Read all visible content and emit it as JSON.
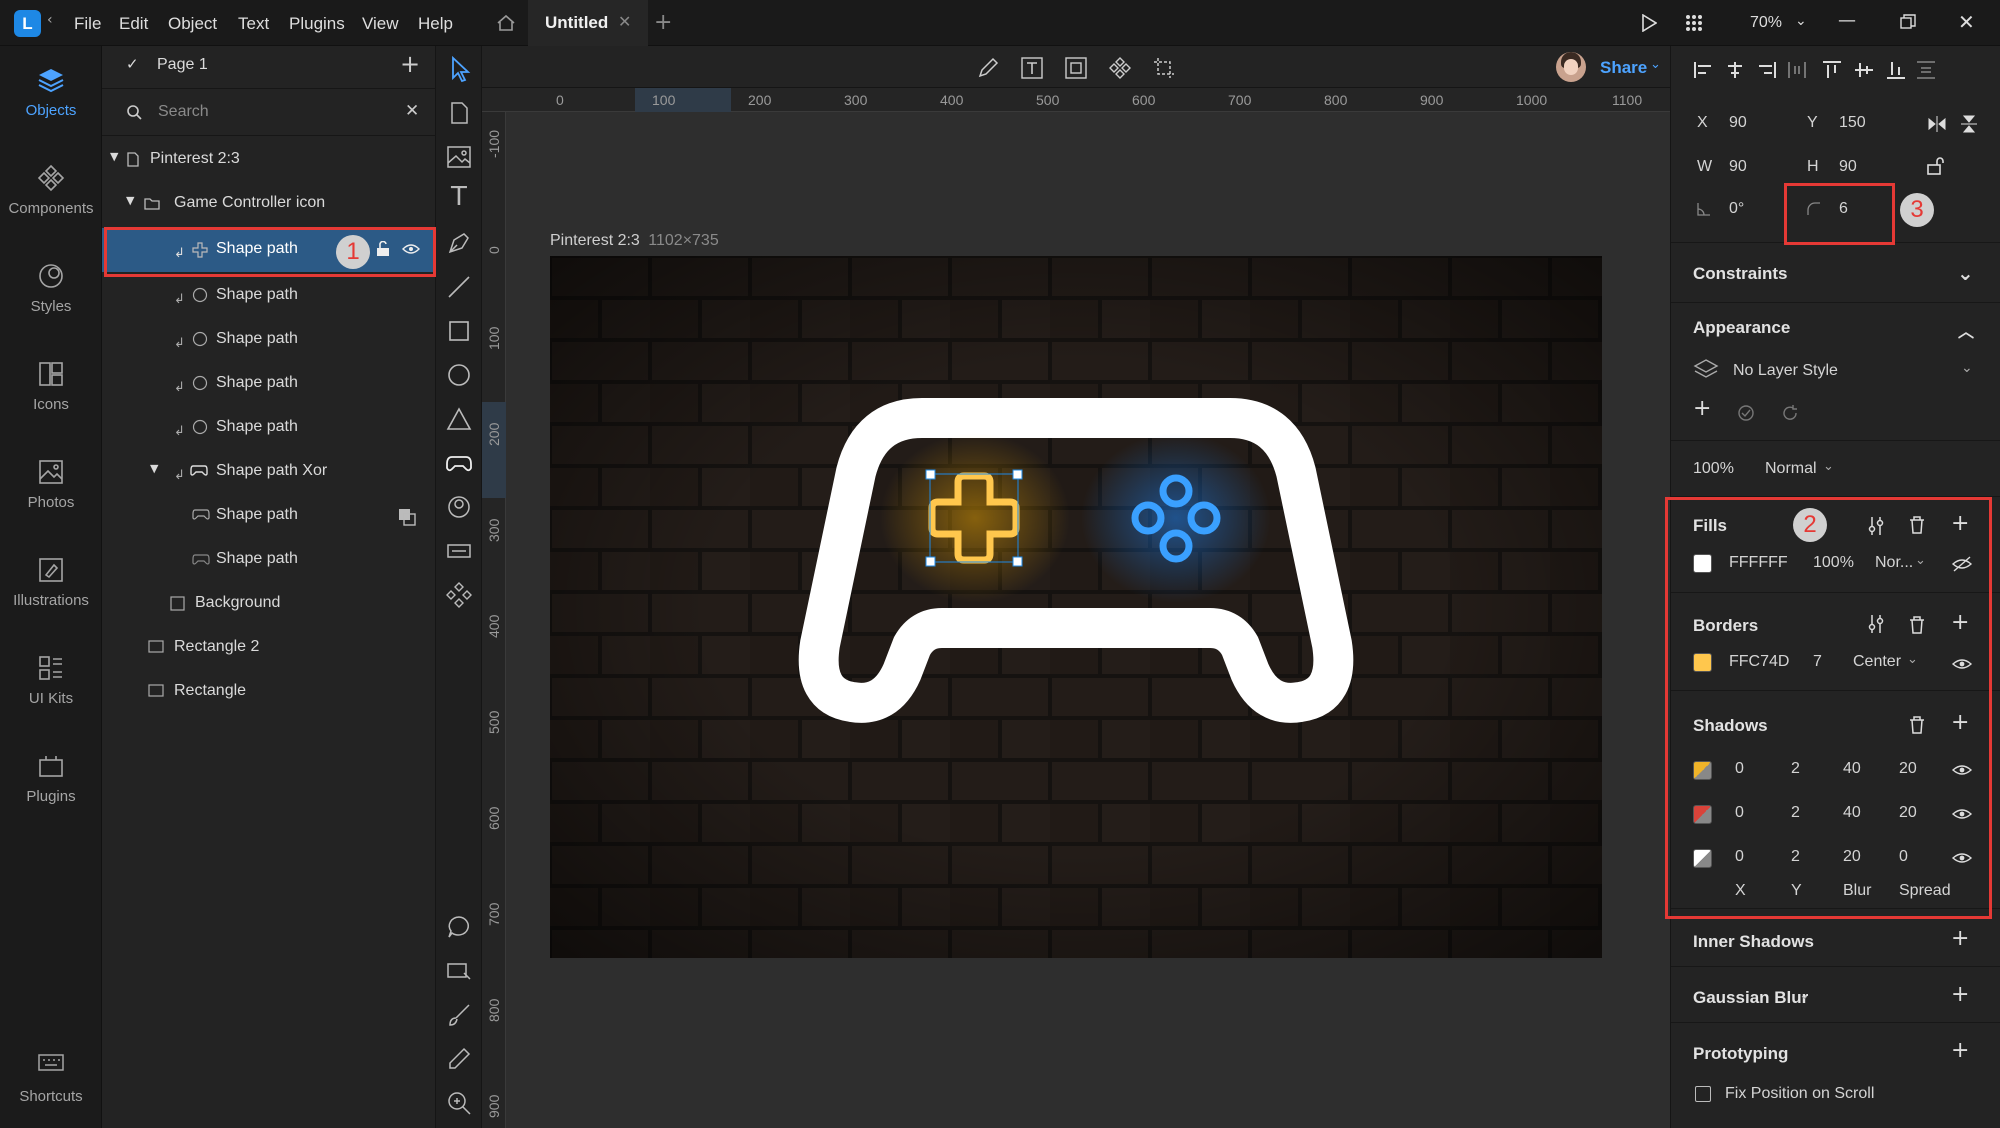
{
  "menubar": {
    "items": [
      "File",
      "Edit",
      "Object",
      "Text",
      "Plugins",
      "View",
      "Help"
    ],
    "tab_title": "Untitled",
    "zoom": "70%"
  },
  "leftnav": {
    "items": [
      "Objects",
      "Components",
      "Styles",
      "Icons",
      "Photos",
      "Illustrations",
      "UI Kits",
      "Plugins"
    ],
    "shortcuts": "Shortcuts"
  },
  "layers": {
    "page": "Page 1",
    "search_placeholder": "Search",
    "artboard": "Pinterest 2:3",
    "group": "Game Controller icon",
    "items": [
      "Shape path",
      "Shape path",
      "Shape path",
      "Shape path",
      "Shape path",
      "Shape path Xor",
      "Shape path",
      "Shape path",
      "Background",
      "Rectangle 2",
      "Rectangle"
    ]
  },
  "canvas": {
    "artboard_label": "Pinterest 2:3",
    "artboard_size": "1102×735",
    "ruler_x": [
      "0",
      "100",
      "200",
      "300",
      "400",
      "500",
      "600",
      "700",
      "800",
      "900",
      "1000",
      "1100"
    ],
    "ruler_y": [
      "-100",
      "0",
      "100",
      "200",
      "300",
      "400",
      "500",
      "600",
      "700",
      "800",
      "900"
    ]
  },
  "toolbar": {
    "share": "Share"
  },
  "inspector": {
    "x_label": "X",
    "x": "90",
    "y_label": "Y",
    "y": "150",
    "w_label": "W",
    "w": "90",
    "h_label": "H",
    "h": "90",
    "rotation": "0°",
    "radius": "6",
    "constraints": "Constraints",
    "appearance": "Appearance",
    "layer_style": "No Layer Style",
    "opacity": "100%",
    "blend": "Normal",
    "fills": {
      "title": "Fills",
      "hex": "FFFFFF",
      "opacity": "100%",
      "blend": "Nor...",
      "color": "#FFFFFF"
    },
    "borders": {
      "title": "Borders",
      "hex": "FFC74D",
      "width": "7",
      "position": "Center",
      "color": "#FFC74D"
    },
    "shadows": {
      "title": "Shadows",
      "rows": [
        {
          "x": "0",
          "y": "2",
          "blur": "40",
          "spread": "20",
          "color": "#F0B429"
        },
        {
          "x": "0",
          "y": "2",
          "blur": "40",
          "spread": "20",
          "color": "#D9433A"
        },
        {
          "x": "0",
          "y": "2",
          "blur": "20",
          "spread": "0",
          "color": "#FFFFFF"
        }
      ],
      "col_labels": [
        "X",
        "Y",
        "Blur",
        "Spread"
      ]
    },
    "inner_shadows": "Inner Shadows",
    "gaussian_blur": "Gaussian Blur",
    "prototyping": "Prototyping",
    "fix_position": "Fix Position on Scroll"
  },
  "annotations": [
    "1",
    "2",
    "3"
  ]
}
